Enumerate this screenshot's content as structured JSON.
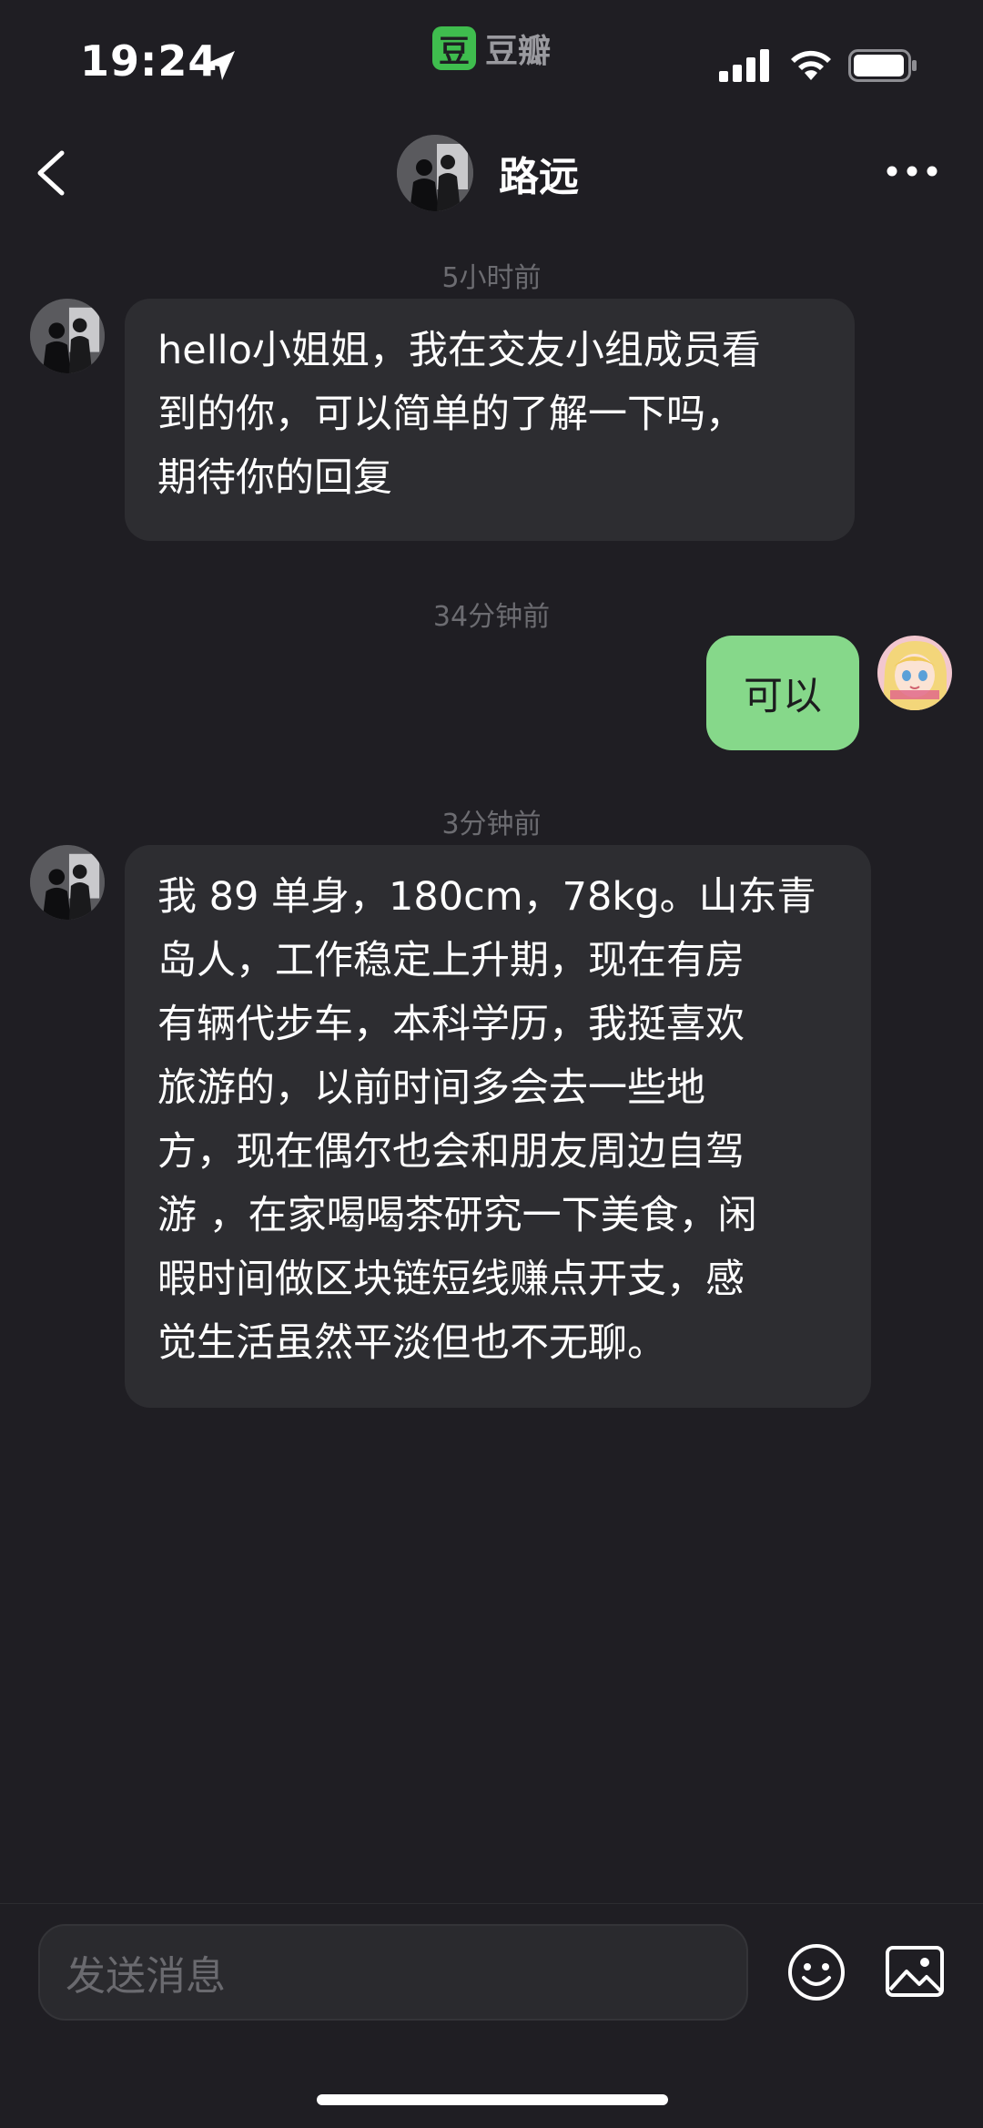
{
  "status_bar": {
    "time": "19:24"
  },
  "app_badge": {
    "logo_char": "豆",
    "name": "豆瓣"
  },
  "header": {
    "title": "路远"
  },
  "messages": [
    {
      "timestamp": "5小时前",
      "sender": "other",
      "lines": [
        "hello小姐姐，我在交友小组成员看",
        "到的你，可以简单的了解一下吗，",
        "期待你的回复"
      ]
    },
    {
      "timestamp": "34分钟前",
      "sender": "me",
      "text": "可以"
    },
    {
      "timestamp": "3分钟前",
      "sender": "other",
      "lines": [
        "我 89 单身，180cm，78kg。山东青",
        "岛人，工作稳定上升期，现在有房",
        "有辆代步车，本科学历，我挺喜欢",
        "旅游的，以前时间多会去一些地",
        "方，现在偶尔也会和朋友周边自驾",
        "游 ，在家喝喝茶研究一下美食，闲",
        "暇时间做区块链短线赚点开支，感",
        "觉生活虽然平淡但也不无聊。"
      ]
    }
  ],
  "input": {
    "placeholder": "发送消息"
  },
  "icons": {
    "back": "back-chevron-icon",
    "more": "more-dots-icon",
    "emoji": "emoji-icon",
    "image": "image-icon"
  },
  "colors": {
    "background": "#1f1e23",
    "bubble_other": "#2d2d31",
    "bubble_me": "#86d88a",
    "app_green": "#3fbd4e"
  }
}
